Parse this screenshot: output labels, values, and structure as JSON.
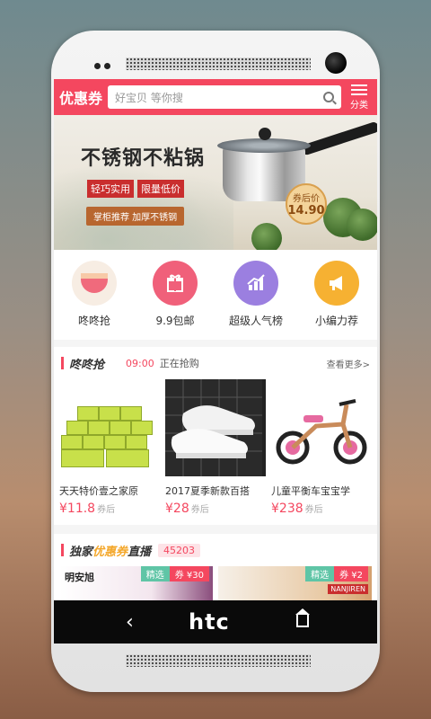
{
  "header": {
    "logo": "优惠券",
    "search_placeholder": "好宝贝 等你搜",
    "category_label": "分类"
  },
  "banner": {
    "title": "不锈钢不粘锅",
    "tags": [
      "轻巧实用",
      "限量低价"
    ],
    "subtitle": "掌柜推荐 加厚不锈钢",
    "price_label": "券后价",
    "price": "14.90"
  },
  "categories": [
    {
      "label": "咚咚抢",
      "icon": "drum-icon",
      "color": "#f7f1ea"
    },
    {
      "label": "9.9包邮",
      "icon": "gift-icon",
      "color": "#f0607a"
    },
    {
      "label": "超级人气榜",
      "icon": "chart-icon",
      "color": "#9b7fe0"
    },
    {
      "label": "小编力荐",
      "icon": "megaphone-icon",
      "color": "#f6b132"
    }
  ],
  "flash_section": {
    "title": "咚咚抢",
    "time": "09:00",
    "status": "正在抢购",
    "more": "查看更多>"
  },
  "products": [
    {
      "name": "天天特价壹之家原",
      "price": "¥11.8",
      "suffix": "券后",
      "image": "tissue-image"
    },
    {
      "name": "2017夏季新款百搭",
      "price": "¥28",
      "suffix": "券后",
      "image": "shoe-image"
    },
    {
      "name": "儿童平衡车宝宝学",
      "price": "¥238",
      "suffix": "券后",
      "image": "bike-image"
    }
  ],
  "live_section": {
    "title_prefix": "独家",
    "title_highlight": "优惠券",
    "title_suffix": "直播",
    "count": "45203"
  },
  "deals": [
    {
      "badge": "精选",
      "coupon": "券 ¥30",
      "brand": "明安旭"
    },
    {
      "badge": "精选",
      "coupon": "券 ¥2",
      "brand": "NANJIREN"
    }
  ],
  "navbar": {
    "back": "‹",
    "logo": "htc"
  }
}
